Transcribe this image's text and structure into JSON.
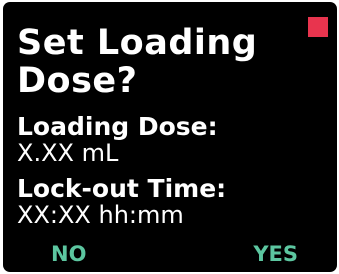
{
  "dialog": {
    "title": "Set Loading Dose?",
    "status_indicator": {
      "icon": "status-square-icon",
      "color": "#e8344e"
    }
  },
  "fields": {
    "loading_dose": {
      "label": "Loading Dose:",
      "value": "X.XX mL"
    },
    "lockout_time": {
      "label": "Lock-out Time:",
      "value": "XX:XX hh:mm"
    }
  },
  "softkeys": {
    "no_label": "NO",
    "yes_label": "YES",
    "color": "#5cc6a0"
  },
  "colors": {
    "screen_background": "#000000",
    "text": "#ffffff"
  }
}
